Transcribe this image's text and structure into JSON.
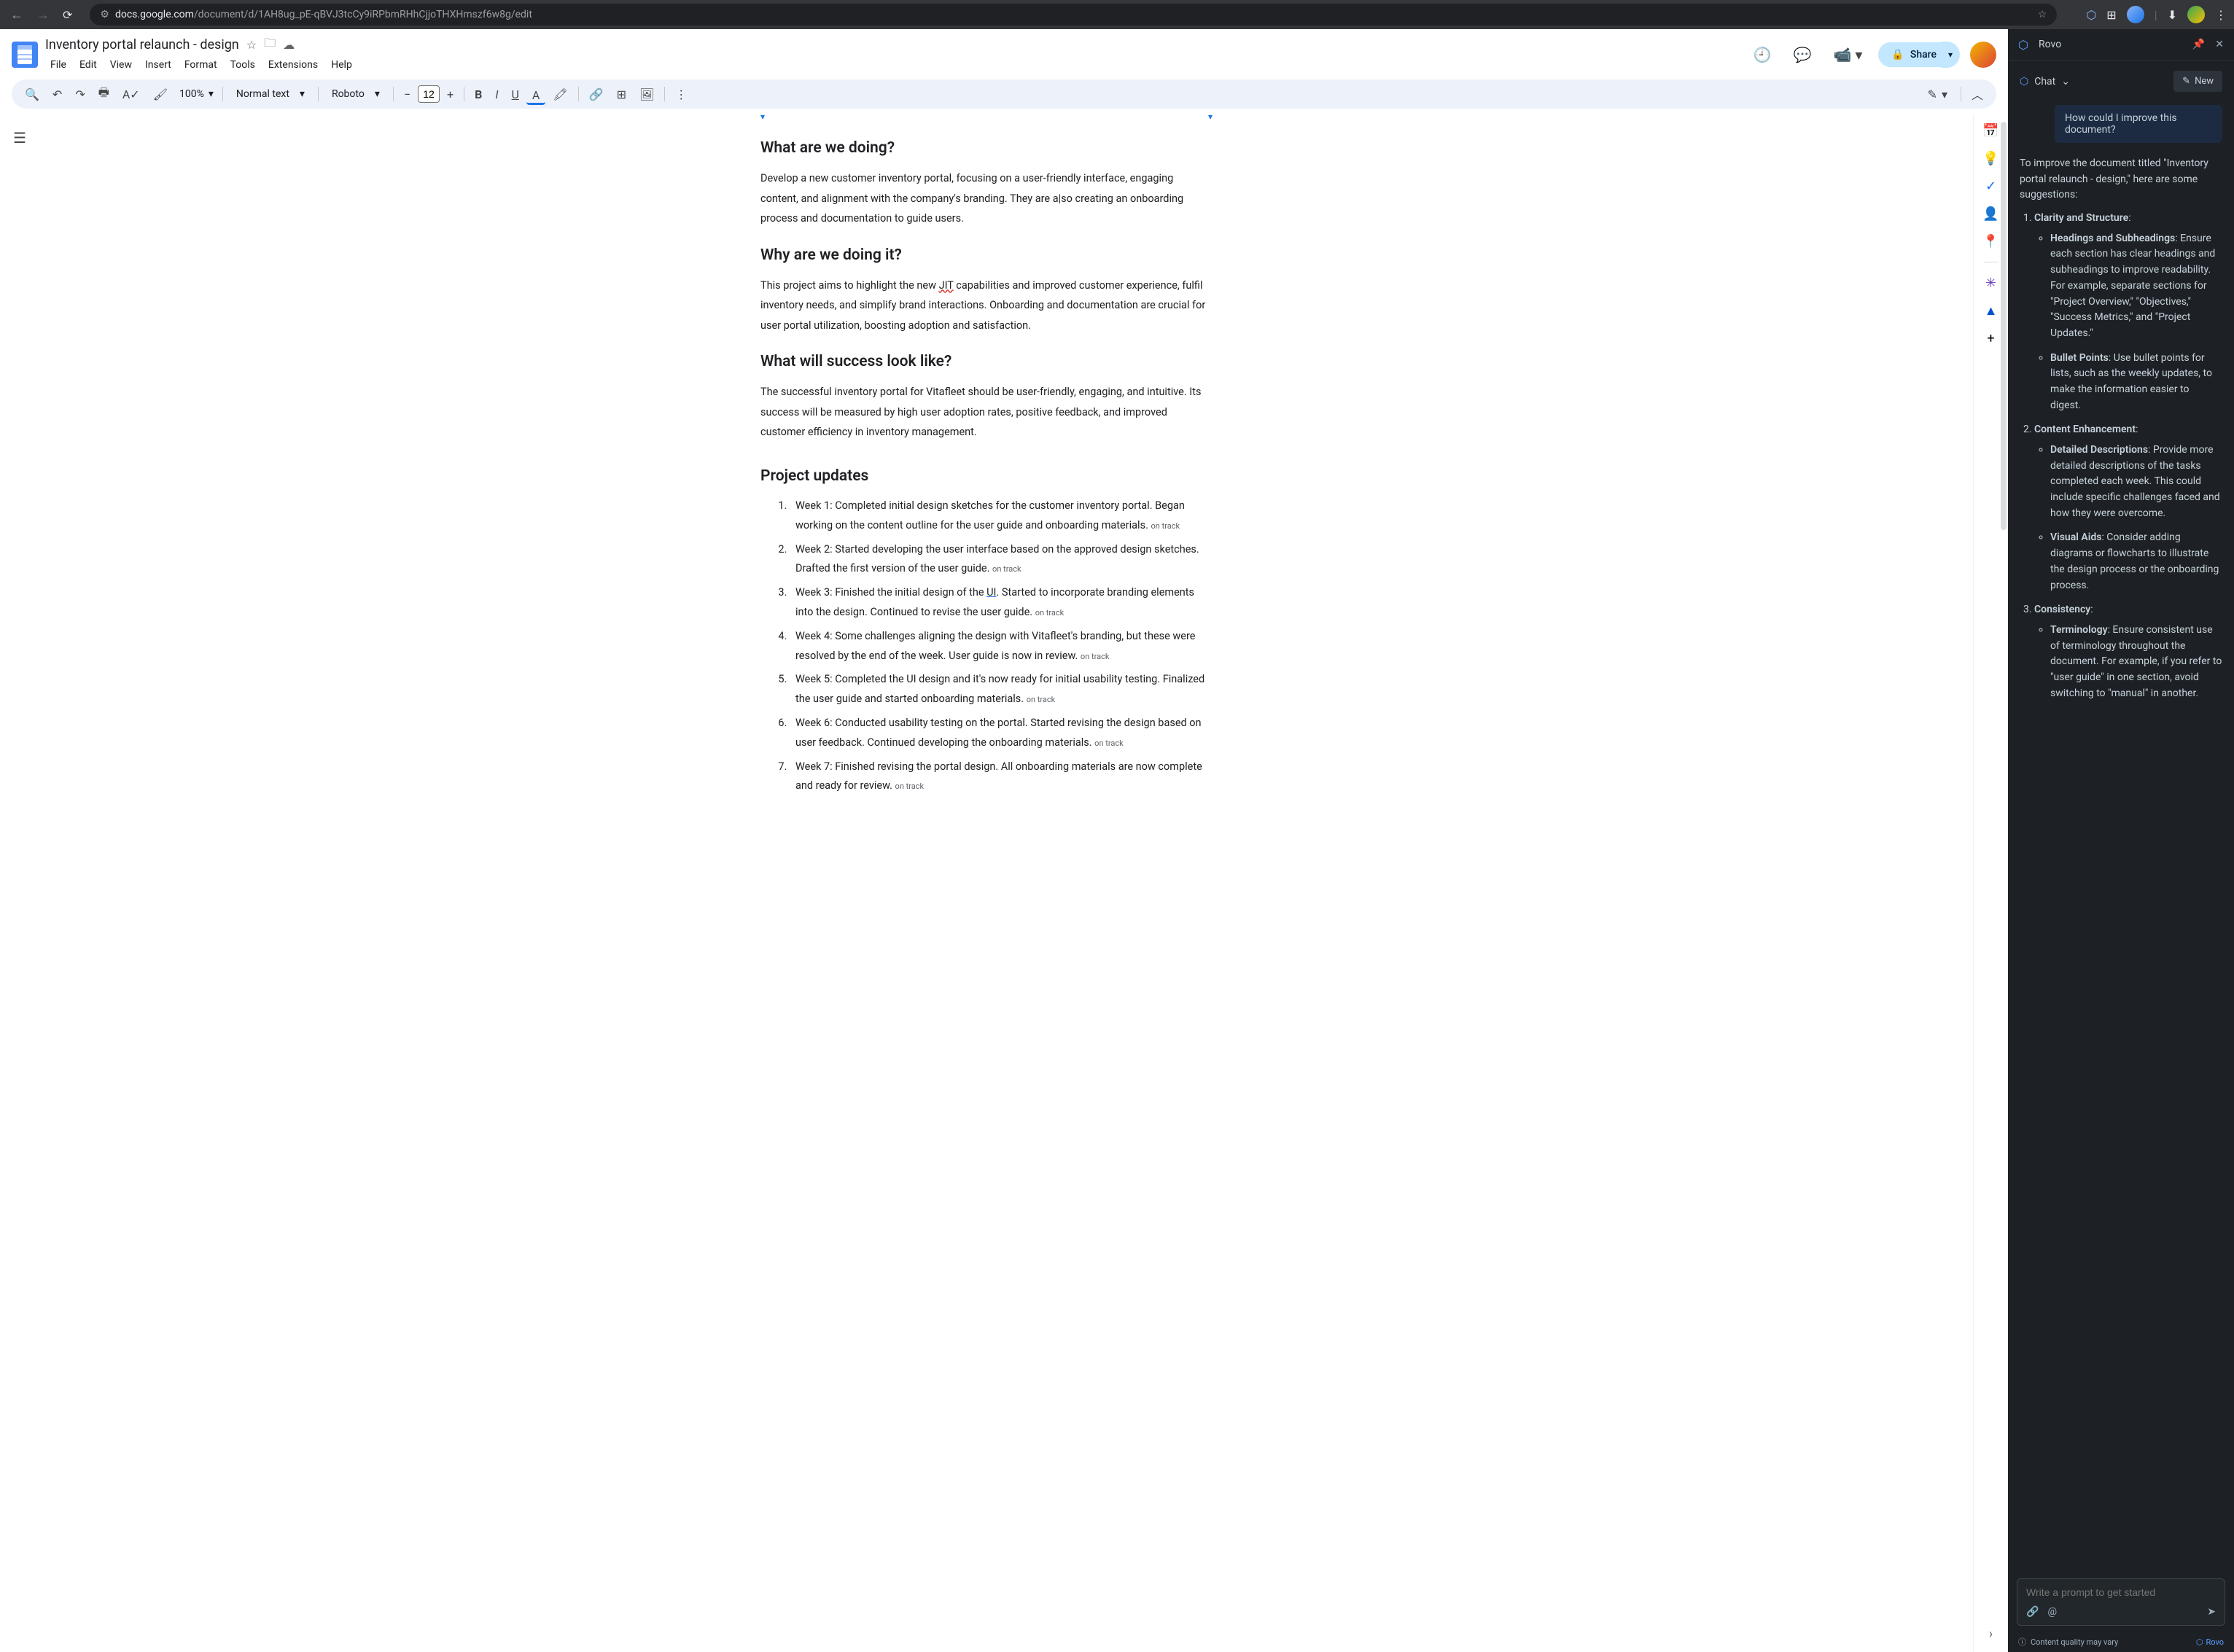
{
  "browser": {
    "url_prefix": "docs.google.com",
    "url_path": "/document/d/1AH8ug_pE-qBVJ3tcCy9iRPbmRHhCjjoTHXHmszf6w8g/edit"
  },
  "docs": {
    "title": "Inventory portal relaunch - design",
    "menus": [
      "File",
      "Edit",
      "View",
      "Insert",
      "Format",
      "Tools",
      "Extensions",
      "Help"
    ],
    "share_label": "Share",
    "toolbar": {
      "zoom": "100%",
      "style": "Normal text",
      "font": "Roboto",
      "font_size": "12"
    }
  },
  "document": {
    "h1": "What are we doing?",
    "p1a": "Develop a new customer inventory portal, focusing on a user-friendly interface, engaging content, and alignment with the company's branding. They are a",
    "p1b": "so creating an onboarding process and documentation to guide users.",
    "h2": "Why are we doing it?",
    "p2a": "This project aims to highlight the new ",
    "p2_jit": "JIT",
    "p2b": " capabilities and improved customer experience, fulfil inventory needs, and simplify brand interactions. Onboarding and documentation are crucial for user portal utilization, boosting adoption and satisfaction.",
    "h3": "What will success look like?",
    "p3": "The successful inventory portal for Vitafleet should be user-friendly, engaging, and intuitive. Its success will be measured by high user adoption rates, positive feedback, and improved customer efficiency in inventory management.",
    "h4": "Project updates",
    "updates": [
      {
        "text": "Week 1: Completed initial design sketches for the customer inventory portal. Began working on the content outline for the user guide and onboarding materials.",
        "status": "on track"
      },
      {
        "text": "Week 2:  Started developing the user interface based on the approved design sketches. Drafted the first version of the user guide.",
        "status": "on track"
      },
      {
        "text_a": "Week 3: Finished the initial design of the ",
        "ui": "UI",
        "text_b": ". Started to incorporate branding elements into the design. Continued to revise the user guide.",
        "status": "on track"
      },
      {
        "text": "Week 4: Some challenges aligning the design with Vitafleet's branding, but these were resolved by the end of the week. User guide is now in review.",
        "status": "on track"
      },
      {
        "text": "Week 5: Completed the UI design and it's now ready for initial usability testing. Finalized the user guide and started onboarding materials.",
        "status": "on track"
      },
      {
        "text": "Week 6: Conducted usability testing on the portal. Started revising the design based on user feedback. Continued developing the onboarding materials.",
        "status": "on track"
      },
      {
        "text": "Week 7: Finished revising the portal design. All onboarding materials are now complete and ready for review.",
        "status": "on track"
      }
    ]
  },
  "rovo": {
    "title": "Rovo",
    "chat_label": "Chat",
    "new_label": "New",
    "user_msg": "How could I improve this document?",
    "intro": "To improve the document titled \"Inventory portal relaunch - design,\" here are some suggestions:",
    "sections": [
      {
        "title": "Clarity and Structure",
        "bullets": [
          {
            "strong": "Headings and Subheadings",
            "text": ": Ensure each section has clear headings and subheadings to improve readability. For example, separate sections for \"Project Overview,\" \"Objectives,\" \"Success Metrics,\" and \"Project Updates.\""
          },
          {
            "strong": "Bullet Points",
            "text": ": Use bullet points for lists, such as the weekly updates, to make the information easier to digest."
          }
        ]
      },
      {
        "title": "Content Enhancement",
        "bullets": [
          {
            "strong": "Detailed Descriptions",
            "text": ": Provide more detailed descriptions of the tasks completed each week. This could include specific challenges faced and how they were overcome."
          },
          {
            "strong": "Visual Aids",
            "text": ": Consider adding diagrams or flowcharts to illustrate the design process or the onboarding process."
          }
        ]
      },
      {
        "title": "Consistency",
        "bullets": [
          {
            "strong": "Terminology",
            "text": ": Ensure consistent use of terminology throughout the document. For example, if you refer to \"user guide\" in one section, avoid switching to \"manual\" in another."
          }
        ]
      }
    ],
    "input_placeholder": "Write a prompt to get started",
    "footer_notice": "Content quality may vary",
    "footer_brand": "Rovo"
  }
}
